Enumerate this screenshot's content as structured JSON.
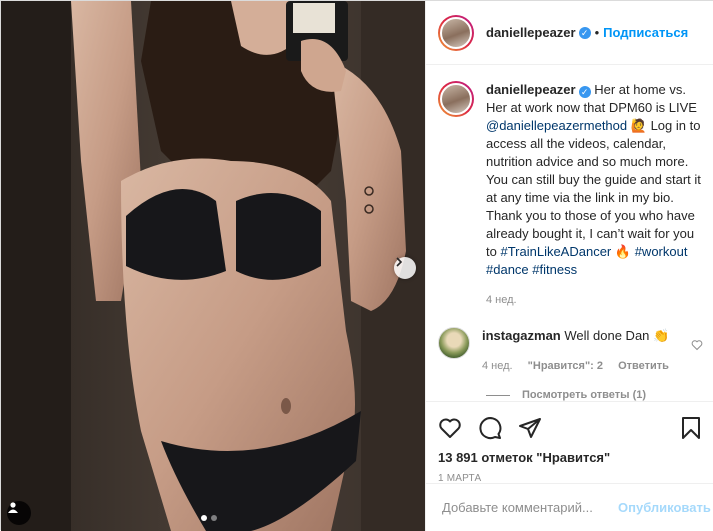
{
  "header": {
    "username": "daniellepeazer",
    "separator": "•",
    "follow_label": "Подписаться",
    "verified_glyph": "✓"
  },
  "caption": {
    "username": "daniellepeazer",
    "text_1": "Her at home vs. Her at work now that DPM60 is LIVE",
    "mention": "@daniellepeazermethod",
    "emoji_1": "🙋",
    "text_2": "Log in to access all the videos, calendar, nutrition advice and so much more. You can still buy the guide and start it at any time via the link in my bio. Thank you to those of you who have already bought it, I can’t wait for you to",
    "hashtag_1": "#TrainLikeADancer",
    "emoji_2": "🔥",
    "hashtag_2": "#workout",
    "hashtag_3": "#dance",
    "hashtag_4": "#fitness",
    "time": "4 нед."
  },
  "comment": {
    "username": "instagazman",
    "text": "Well done Dan",
    "emoji": "👏",
    "time": "4 нед.",
    "likes": "\"Нравится\": 2",
    "reply_label": "Ответить",
    "view_replies": "Посмотреть ответы (1)"
  },
  "post": {
    "likes_text": "13 891 отметок \"Нравится\"",
    "date": "1 МАРТА",
    "carousel_total": 2,
    "carousel_active": 1
  },
  "add_comment": {
    "placeholder": "Добавьте комментарий...",
    "publish_label": "Опубликовать"
  },
  "colors": {
    "accent": "#0095f6",
    "verified": "#3897f0",
    "secondary_text": "#8e8e8e",
    "link": "#00376b"
  },
  "icons": {
    "like": "heart-icon",
    "comment": "comment-icon",
    "share": "paper-plane-icon",
    "save": "bookmark-icon",
    "next": "chevron-right-icon",
    "tagged": "user-tag-icon"
  }
}
